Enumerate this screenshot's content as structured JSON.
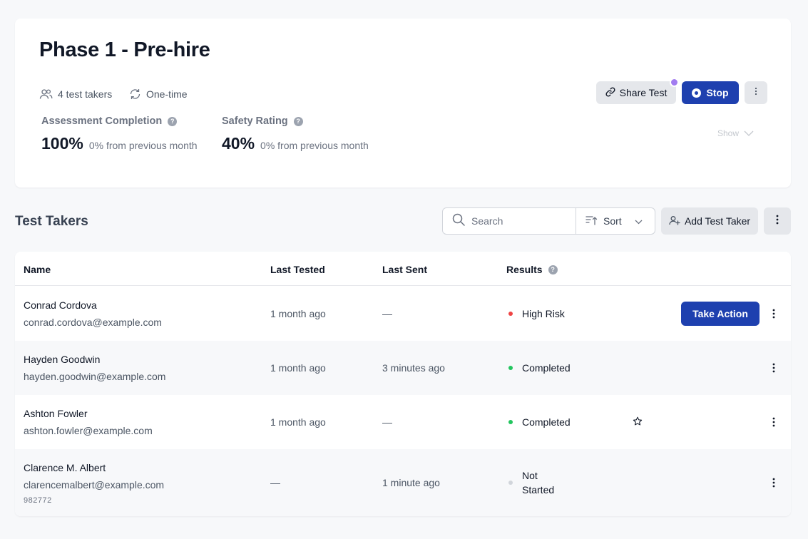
{
  "header": {
    "title": "Phase 1 - Pre-hire",
    "test_takers": "4 test takers",
    "frequency": "One-time",
    "share_label": "Share Test",
    "stop_label": "Stop",
    "show_label": "Show"
  },
  "stats": [
    {
      "label": "Assessment Completion",
      "value": "100%",
      "delta": "0% from previous month"
    },
    {
      "label": "Safety Rating",
      "value": "40%",
      "delta": "0% from previous month"
    }
  ],
  "section": {
    "title": "Test Takers",
    "search_placeholder": "Search",
    "sort_label": "Sort",
    "add_label": "Add Test Taker"
  },
  "table": {
    "columns": [
      "Name",
      "Last Tested",
      "Last Sent",
      "Results"
    ],
    "rows": [
      {
        "name": "Conrad Cordova",
        "email": "conrad.cordova@example.com",
        "last_tested": "1 month ago",
        "last_sent": "—",
        "result": "High Risk",
        "result_color": "#ef4444",
        "action": "Take Action"
      },
      {
        "name": "Hayden Goodwin",
        "email": "hayden.goodwin@example.com",
        "last_tested": "1 month ago",
        "last_sent": "3 minutes ago",
        "result": "Completed",
        "result_color": "#22c55e"
      },
      {
        "name": "Ashton Fowler",
        "email": "ashton.fowler@example.com",
        "last_tested": "1 month ago",
        "last_sent": "—",
        "result": "Completed",
        "result_color": "#22c55e",
        "starred": "star-icon"
      },
      {
        "name": "Clarence M. Albert",
        "email": "clarencemalbert@example.com",
        "extra": "982772",
        "last_tested": "—",
        "last_sent": "1 minute ago",
        "result_line1": "Not",
        "result_line2": "Started",
        "result_color": "#d1d5db"
      }
    ]
  },
  "colors": {
    "primary": "#1e40af",
    "notification_dot": "#a27cf0",
    "background": "#f7f8fa"
  }
}
